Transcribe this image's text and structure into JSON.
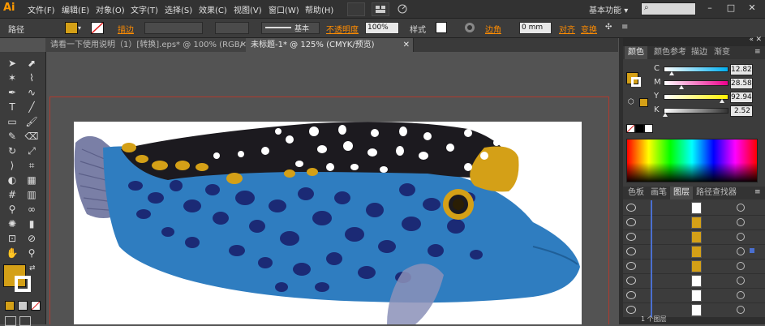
{
  "app": {
    "logo": "Ai"
  },
  "menu": [
    "文件(F)",
    "编辑(E)",
    "对象(O)",
    "文字(T)",
    "选择(S)",
    "效果(C)",
    "视图(V)",
    "窗口(W)",
    "帮助(H)"
  ],
  "workspace": {
    "label": "基本功能"
  },
  "window_controls": {
    "minimize": "–",
    "maximize": "□",
    "close": "✕"
  },
  "control_bar": {
    "selection_label": "路径",
    "stroke_label": "描边",
    "stroke_style": "基本",
    "opacity_label": "不透明度",
    "opacity_value": "100%",
    "style_label": "样式",
    "corner_label": "边角",
    "corner_value": "0 mm",
    "align_label": "对齐",
    "transform_label": "变换"
  },
  "tabs": [
    {
      "label": "请看一下使用说明（1）[转换].eps* @ 100% (RGB/预览)",
      "close": "✕"
    },
    {
      "label": "未标题-1* @ 125% (CMYK/预览)",
      "close": "✕"
    }
  ],
  "colors": {
    "fill": "#d4a017",
    "fish_blue": "#2f7dc0",
    "fish_spots": "#1b2a75",
    "fish_dark": "#1c1a1f",
    "fish_yellow": "#d4a017",
    "fin_gray": "#7a7fa6",
    "artboard_border": "#b03a2e"
  },
  "panel": {
    "tabs": [
      "颜色",
      "颜色参考",
      "描边",
      "渐变"
    ],
    "cmyk": [
      {
        "label": "C",
        "value": "12.82",
        "color": "#00aeef"
      },
      {
        "label": "M",
        "value": "28.58",
        "color": "#ec008c"
      },
      {
        "label": "Y",
        "value": "92.94",
        "color": "#fff200"
      },
      {
        "label": "K",
        "value": "2.52",
        "color": "#333333"
      }
    ],
    "layers_tabs": [
      "色板",
      "画笔",
      "图层",
      "路径查找器"
    ],
    "layers_footer": "1 个图层",
    "layer_rows": 8
  },
  "tools": [
    "selection-tool",
    "direct-selection-tool",
    "magic-wand-tool",
    "lasso-tool",
    "pen-tool",
    "curvature-tool",
    "type-tool",
    "line-tool",
    "rectangle-tool",
    "paintbrush-tool",
    "pencil-tool",
    "eraser-tool",
    "rotate-tool",
    "scale-tool",
    "width-tool",
    "free-transform-tool",
    "shape-builder-tool",
    "perspective-tool",
    "mesh-tool",
    "gradient-tool",
    "eyedropper-tool",
    "blend-tool",
    "symbol-sprayer-tool",
    "column-graph-tool",
    "artboard-tool",
    "slice-tool",
    "hand-tool",
    "zoom-tool"
  ]
}
